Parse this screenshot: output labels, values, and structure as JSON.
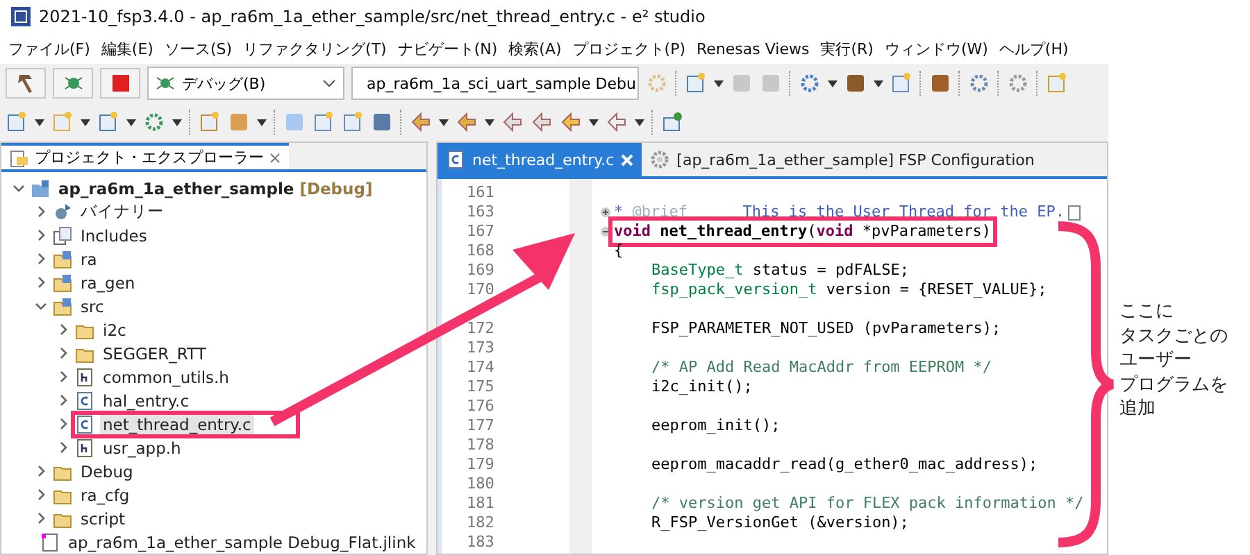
{
  "window": {
    "title": "2021-10_fsp3.4.0 - ap_ra6m_1a_ether_sample/src/net_thread_entry.c - e² studio"
  },
  "menu": [
    "ファイル(F)",
    "編集(E)",
    "ソース(S)",
    "リファクタリング(T)",
    "ナビゲート(N)",
    "検索(A)",
    "プロジェクト(P)",
    "Renesas Views",
    "実行(R)",
    "ウィンドウ(W)",
    "ヘルプ(H)"
  ],
  "toolbar": {
    "build_config": "デバッグ(B)",
    "launch_config": "ap_ra6m_1a_sci_uart_sample Debu"
  },
  "explorer": {
    "title": "プロジェクト・エクスプローラー",
    "tree": [
      {
        "kind": "project",
        "label": "ap_ra6m_1a_ether_sample",
        "suffix": "[Debug]",
        "expanded": true,
        "children": [
          {
            "kind": "binaries",
            "label": "バイナリー",
            "expanded": false
          },
          {
            "kind": "includes",
            "label": "Includes",
            "expanded": false
          },
          {
            "kind": "source-folder",
            "label": "ra",
            "expanded": false
          },
          {
            "kind": "source-folder",
            "label": "ra_gen",
            "expanded": false
          },
          {
            "kind": "source-folder",
            "label": "src",
            "expanded": true,
            "children": [
              {
                "kind": "folder",
                "label": "i2c",
                "expanded": false
              },
              {
                "kind": "folder",
                "label": "SEGGER_RTT",
                "expanded": false
              },
              {
                "kind": "header",
                "label": "common_utils.h",
                "expanded": false
              },
              {
                "kind": "c-file",
                "label": "hal_entry.c",
                "expanded": false
              },
              {
                "kind": "c-file",
                "label": "net_thread_entry.c",
                "expanded": false,
                "selected": true,
                "highlighted": true
              },
              {
                "kind": "header",
                "label": "usr_app.h",
                "expanded": false
              }
            ]
          },
          {
            "kind": "folder",
            "label": "Debug",
            "expanded": false
          },
          {
            "kind": "folder",
            "label": "ra_cfg",
            "expanded": false
          },
          {
            "kind": "folder",
            "label": "script",
            "expanded": false
          },
          {
            "kind": "launch",
            "label": "ap_ra6m_1a_ether_sample Debug_Flat.jlink"
          }
        ]
      }
    ]
  },
  "editor": {
    "tabs": [
      {
        "label": "net_thread_entry.c",
        "kind": "c-file",
        "selected": true
      },
      {
        "label": "[ap_ra6m_1a_ether_sample] FSP Configuration",
        "kind": "config",
        "selected": false
      }
    ],
    "lines": [
      {
        "number": "161"
      },
      {
        "number": "163",
        "folded": true,
        "more": true,
        "segments": [
          {
            "kind": "doc",
            "text": "* "
          },
          {
            "kind": "doctag",
            "text": "@brief"
          },
          {
            "kind": "doc",
            "text": "      This is the User Thread for the EP."
          }
        ]
      },
      {
        "number": "167",
        "folded": false,
        "highlighted": true,
        "segments": [
          {
            "kind": "keyword",
            "text": "void"
          },
          {
            "kind": "bold",
            "text": " net_thread_entry"
          },
          {
            "kind": "plain",
            "text": "("
          },
          {
            "kind": "keyword",
            "text": "void"
          },
          {
            "kind": "plain",
            "text": " *pvParameters)"
          }
        ]
      },
      {
        "number": "168",
        "segments": [
          {
            "kind": "plain",
            "text": "{"
          }
        ]
      },
      {
        "number": "169",
        "indent": true,
        "segments": [
          {
            "kind": "type",
            "text": "BaseType_t"
          },
          {
            "kind": "plain",
            "text": " status = pdFALSE;"
          }
        ]
      },
      {
        "number": "170",
        "indent": true,
        "segments": [
          {
            "kind": "type",
            "text": "fsp_pack_version_t"
          },
          {
            "kind": "plain",
            "text": " version = {RESET_VALUE};"
          }
        ]
      },
      {
        "kind": "covered"
      },
      {
        "number": "172",
        "indent": true,
        "segments": [
          {
            "kind": "plain",
            "text": "FSP_PARAMETER_NOT_USED (pvParameters);"
          }
        ]
      },
      {
        "number": "173"
      },
      {
        "number": "174",
        "indent": true,
        "segments": [
          {
            "kind": "comment",
            "text": "/* AP Add Read MacAddr from EEPROM */"
          }
        ]
      },
      {
        "number": "175",
        "indent": true,
        "segments": [
          {
            "kind": "plain",
            "text": "i2c_init();"
          }
        ]
      },
      {
        "number": "176"
      },
      {
        "number": "177",
        "indent": true,
        "segments": [
          {
            "kind": "plain",
            "text": "eeprom_init();"
          }
        ]
      },
      {
        "number": "178"
      },
      {
        "number": "179",
        "indent": true,
        "segments": [
          {
            "kind": "plain",
            "text": "eeprom_macaddr_read(g_ether0_mac_address);"
          }
        ]
      },
      {
        "number": "180"
      },
      {
        "number": "181",
        "indent": true,
        "segments": [
          {
            "kind": "comment",
            "text": "/* version get API for FLEX pack information */"
          }
        ]
      },
      {
        "number": "182",
        "indent": true,
        "segments": [
          {
            "kind": "plain",
            "text": "R_FSP_VersionGet (&version);"
          }
        ]
      },
      {
        "number": "183"
      }
    ]
  },
  "annotation": {
    "lines": [
      "ここに",
      "タスクごとの",
      "ユーザー",
      "プログラムを",
      "追加"
    ]
  }
}
